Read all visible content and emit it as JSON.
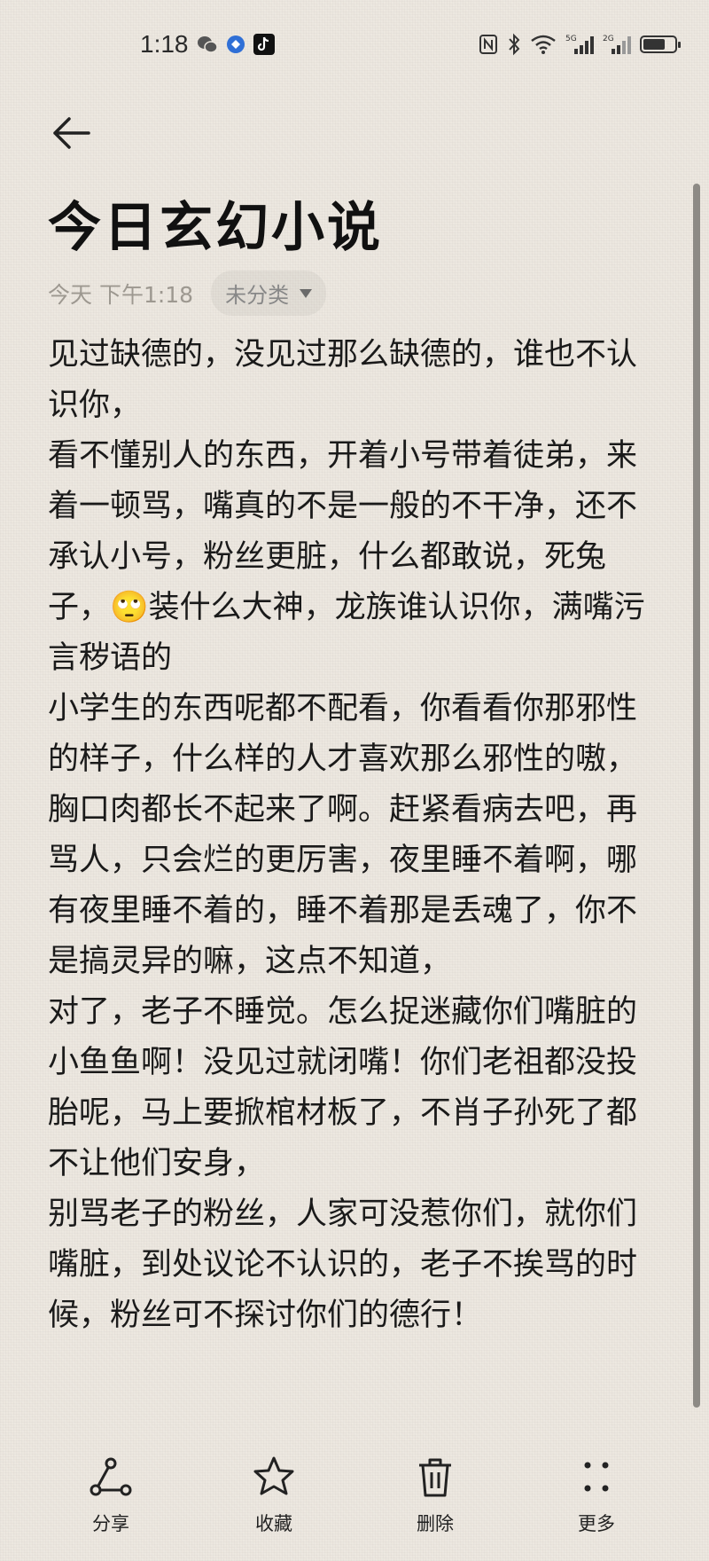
{
  "status_bar": {
    "time": "1:18"
  },
  "note": {
    "title": "今日玄幻小说",
    "date": "今天 下午1:18",
    "category": "未分类",
    "paragraphs": [
      "见过缺德的，没见过那么缺德的，谁也不认识你，",
      "看不懂别人的东西，开着小号带着徒弟，来着一顿骂，嘴真的不是一般的不干净，还不承认小号，粉丝更脏，什么都敢说，死兔子，🙄装什么大神，龙族谁认识你，满嘴污言秽语的",
      "小学生的东西呢都不配看，你看看你那邪性的样子，什么样的人才喜欢那么邪性的嗷，胸口肉都长不起来了啊。赶紧看病去吧，再骂人，只会烂的更厉害，夜里睡不着啊，哪有夜里睡不着的，睡不着那是丢魂了，你不是搞灵异的嘛，这点不知道，",
      "对了，老子不睡觉。怎么捉迷藏你们嘴脏的小鱼鱼啊！没见过就闭嘴！你们老祖都没投胎呢，马上要掀棺材板了，不肖子孙死了都不让他们安身，",
      "别骂老子的粉丝，人家可没惹你们，就你们嘴脏，到处议论不认识的，老子不挨骂的时候，粉丝可不探讨你们的德行！"
    ]
  },
  "toolbar": {
    "share": "分享",
    "favorite": "收藏",
    "delete": "删除",
    "more": "更多"
  },
  "icons": [
    "back-arrow-icon",
    "share-icon",
    "star-icon",
    "trash-icon",
    "more-dots-icon"
  ],
  "battery_level": 0.7
}
